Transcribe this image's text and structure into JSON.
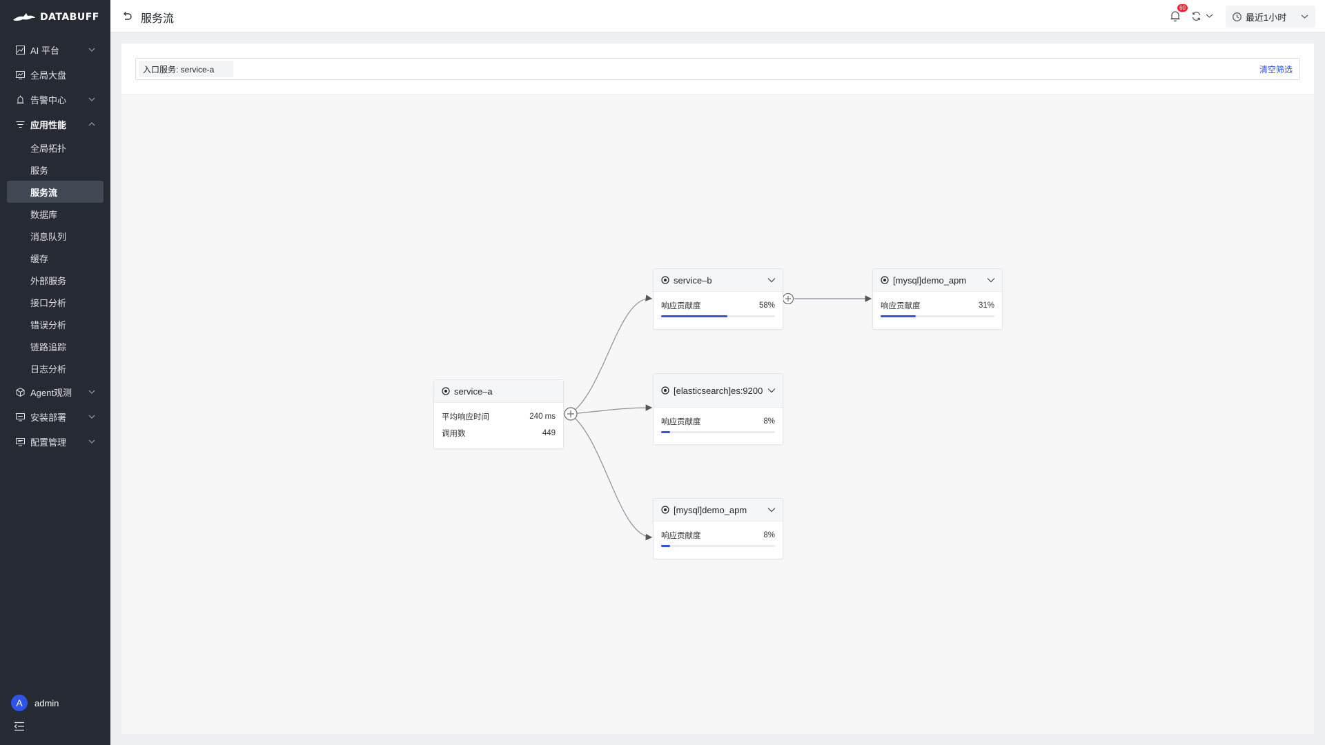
{
  "app": {
    "name": "DATABUFF"
  },
  "sidebar": {
    "menu": [
      {
        "label": "AI 平台",
        "icon": "chart-line-icon",
        "expandable": true
      },
      {
        "label": "全局大盘",
        "icon": "dashboard-icon",
        "expandable": false
      },
      {
        "label": "告警中心",
        "icon": "alarm-icon",
        "expandable": true
      }
    ],
    "apm": {
      "label": "应用性能",
      "icon": "filter-lines-icon",
      "children": [
        "全局拓扑",
        "服务",
        "服务流",
        "数据库",
        "消息队列",
        "缓存",
        "外部服务",
        "接口分析",
        "错误分析",
        "链路追踪",
        "日志分析"
      ],
      "active": "服务流"
    },
    "menu_bottom": [
      {
        "label": "Agent观测",
        "icon": "cube-icon"
      },
      {
        "label": "安装部署",
        "icon": "monitor-icon"
      },
      {
        "label": "配置管理",
        "icon": "settings-monitor-icon"
      }
    ],
    "user": {
      "initial": "A",
      "name": "admin"
    }
  },
  "header": {
    "title": "服务流",
    "notification_count": "60",
    "time_range": "最近1小时"
  },
  "filter": {
    "tag": "入口服务: service-a",
    "clear_label": "清空筛选"
  },
  "graph": {
    "nodes": {
      "service_a": {
        "name": "service–a",
        "avg_label": "平均响应时间",
        "avg_value": "240 ms",
        "calls_label": "调用数",
        "calls_value": "449"
      },
      "service_b": {
        "name": "service–b",
        "metric_label": "响应贡献度",
        "value": "58%",
        "fraction": 0.58
      },
      "mysql_b": {
        "name": "[mysql]demo_apm",
        "metric_label": "响应贡献度",
        "value": "31%",
        "fraction": 0.31
      },
      "es": {
        "name": "[elasticsearch]es:9200",
        "metric_label": "响应贡献度",
        "value": "8%",
        "fraction": 0.08
      },
      "mysql_a": {
        "name": "[mysql]demo_apm",
        "metric_label": "响应贡献度",
        "value": "8%",
        "fraction": 0.08
      }
    }
  },
  "colors": {
    "accent": "#2f54eb",
    "sidebar": "#262b33",
    "badge": "#f5222d"
  }
}
